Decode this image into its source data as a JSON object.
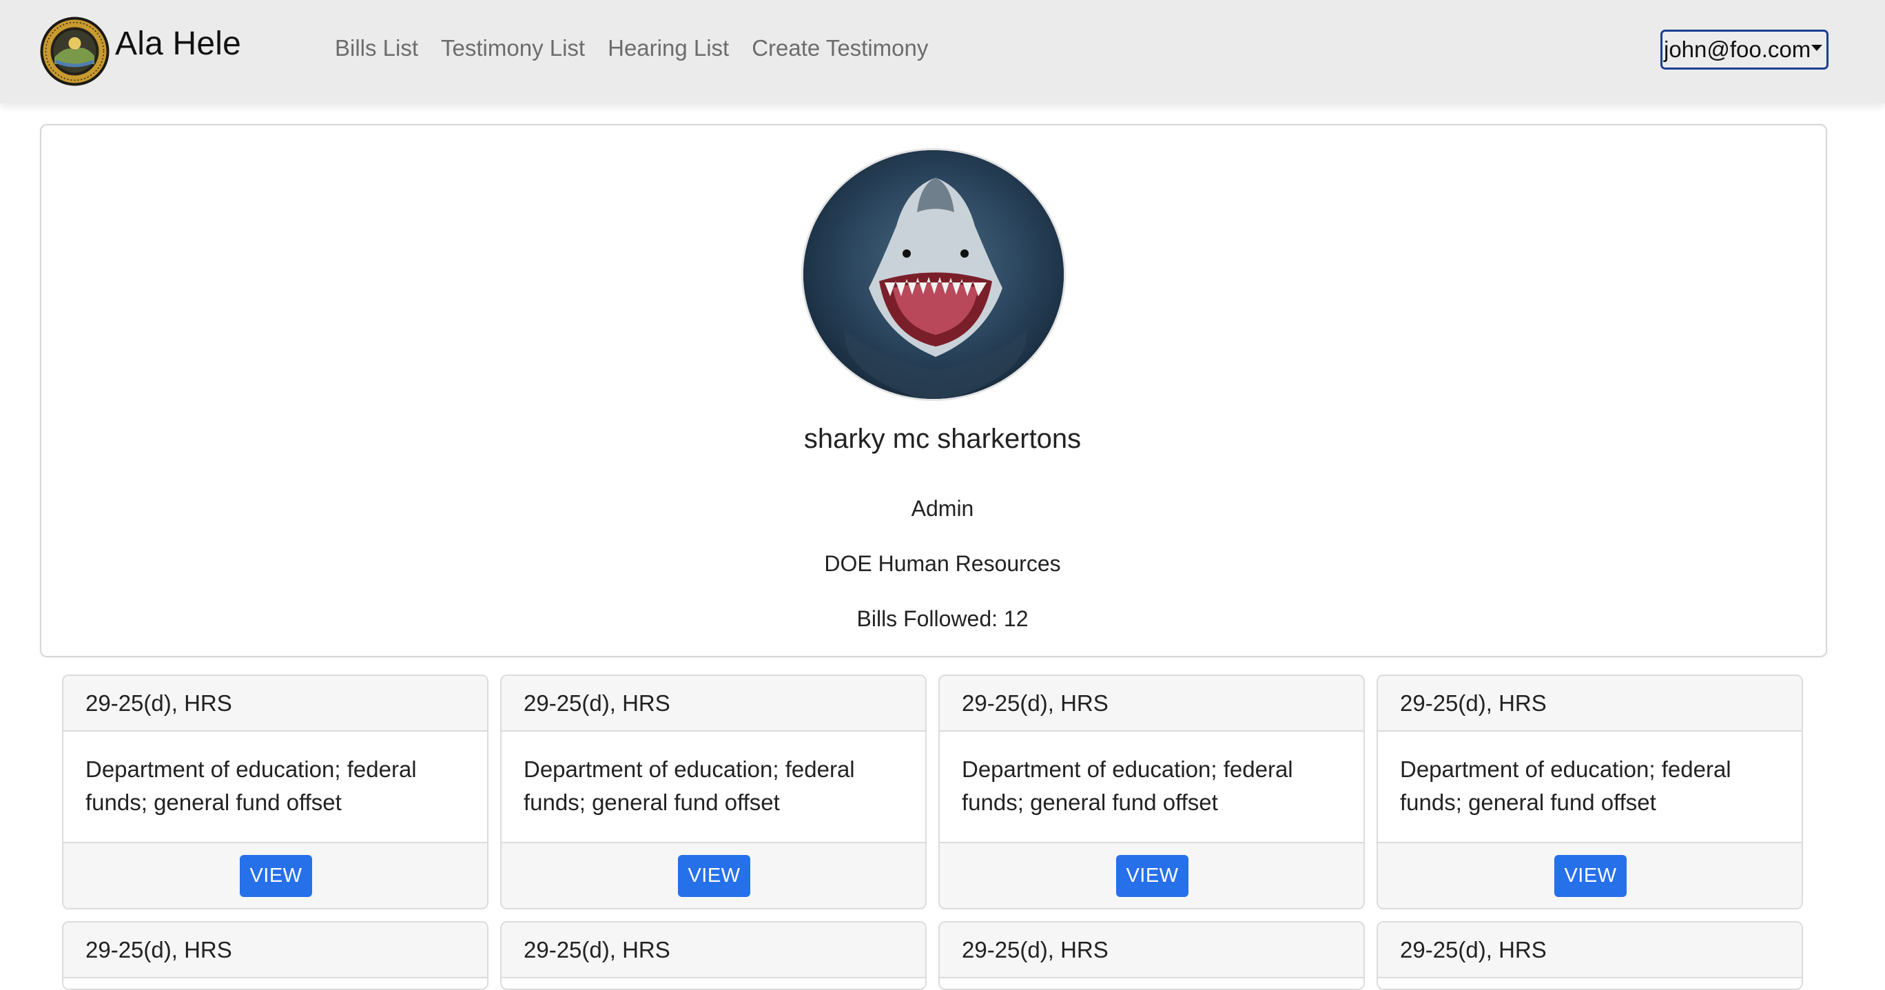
{
  "navbar": {
    "brand": "Ala Hele",
    "links": [
      "Bills List",
      "Testimony List",
      "Hearing List",
      "Create Testimony"
    ],
    "user_email": "john@foo.com"
  },
  "profile": {
    "name": "sharky mc sharkertons",
    "role": "Admin",
    "department": "DOE Human Resources",
    "bills_followed": "Bills Followed: 12"
  },
  "bills": [
    {
      "code": "29-25(d), HRS",
      "description": "Department of education; federal funds; general fund offset",
      "button": "VIEW"
    },
    {
      "code": "29-25(d), HRS",
      "description": "Department of education; federal funds; general fund offset",
      "button": "VIEW"
    },
    {
      "code": "29-25(d), HRS",
      "description": "Department of education; federal funds; general fund offset",
      "button": "VIEW"
    },
    {
      "code": "29-25(d), HRS",
      "description": "Department of education; federal funds; general fund offset",
      "button": "VIEW"
    },
    {
      "code": "29-25(d), HRS"
    },
    {
      "code": "29-25(d), HRS"
    },
    {
      "code": "29-25(d), HRS"
    },
    {
      "code": "29-25(d), HRS"
    }
  ],
  "colors": {
    "navbar_bg": "#ebebeb",
    "primary_button": "#2670ea",
    "dropdown_border": "#1a3f8f"
  },
  "icons": {
    "logo": "state-seal-logo",
    "dropdown": "caret-down-icon"
  }
}
